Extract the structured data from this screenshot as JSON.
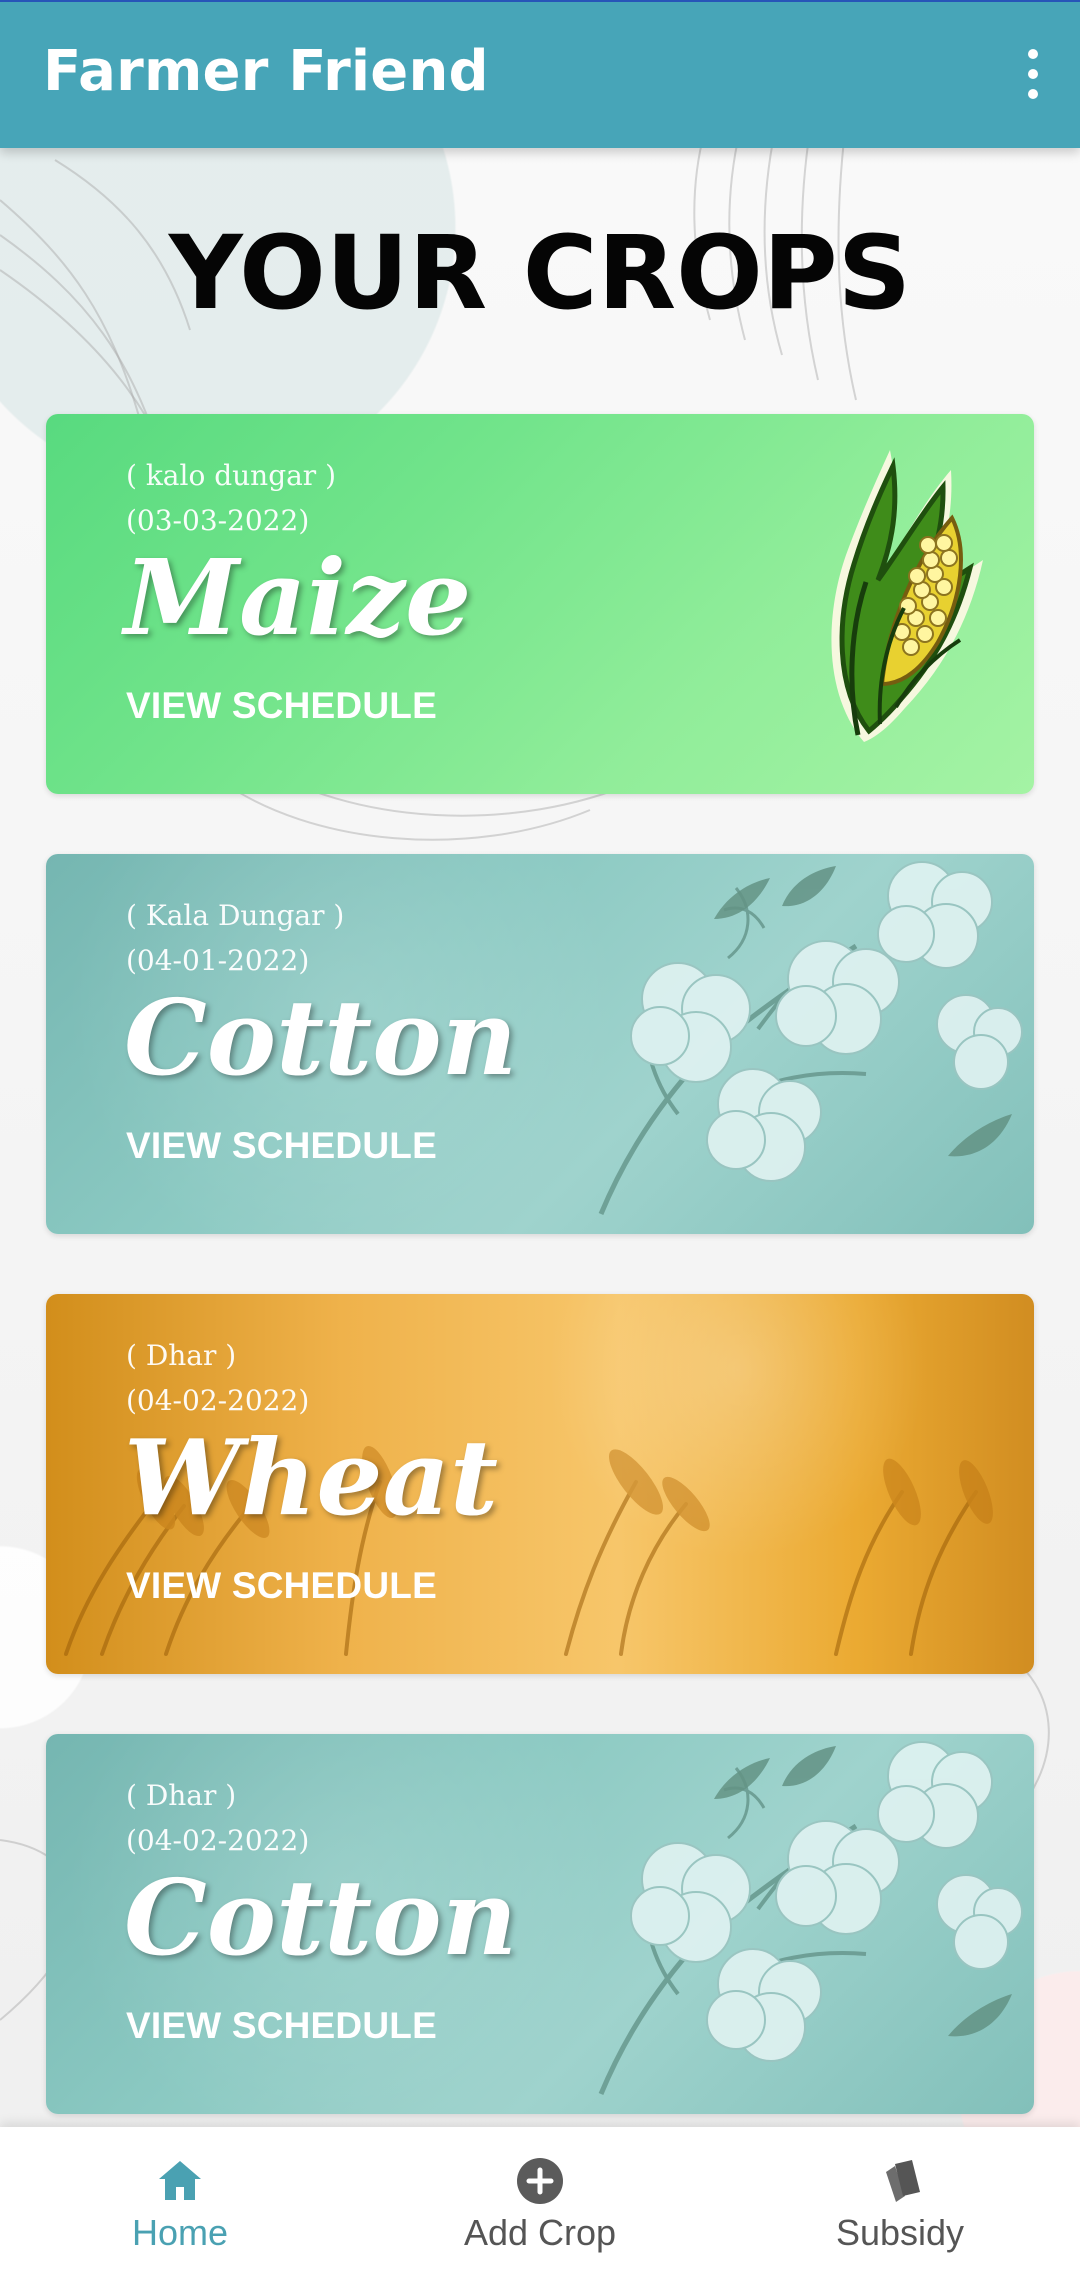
{
  "app": {
    "title": "Farmer Friend",
    "accent": "#47a5b8"
  },
  "menu": {
    "icon": "more-vert-icon"
  },
  "page": {
    "title": "YOUR CROPS"
  },
  "crops": [
    {
      "location": "( kalo dungar )",
      "date": "(03-03-2022)",
      "name": "Maize",
      "action_label": "VIEW SCHEDULE",
      "theme": "maize",
      "icon": "corn-icon"
    },
    {
      "location": "( Kala Dungar )",
      "date": "(04-01-2022)",
      "name": "Cotton",
      "action_label": "VIEW SCHEDULE",
      "theme": "cotton",
      "icon": "cotton-plant-icon"
    },
    {
      "location": "( Dhar )",
      "date": "(04-02-2022)",
      "name": "Wheat",
      "action_label": "VIEW SCHEDULE",
      "theme": "wheat",
      "icon": "wheat-icon"
    },
    {
      "location": "( Dhar )",
      "date": "(04-02-2022)",
      "name": "Cotton",
      "action_label": "VIEW SCHEDULE",
      "theme": "cotton",
      "icon": "cotton-plant-icon"
    }
  ],
  "bottom_nav": {
    "items": [
      {
        "label": "Home",
        "icon": "home-icon",
        "active": true
      },
      {
        "label": "Add Crop",
        "icon": "add-circle-icon",
        "active": false
      },
      {
        "label": "Subsidy",
        "icon": "cards-icon",
        "active": false
      }
    ]
  }
}
